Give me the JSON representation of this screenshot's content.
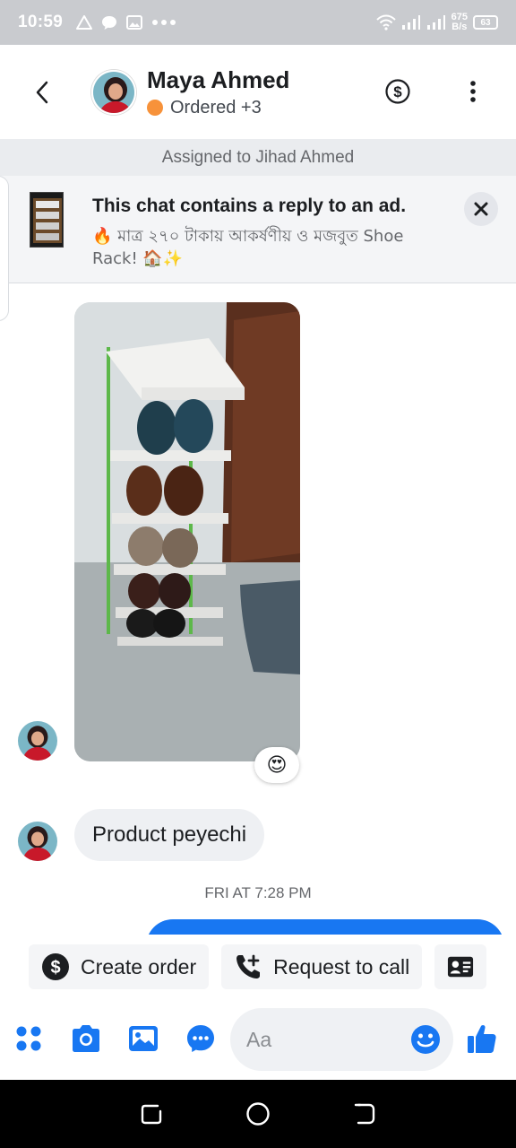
{
  "status_bar": {
    "time": "10:59",
    "network_speed_value": "675",
    "network_speed_unit": "B/s",
    "battery": "63"
  },
  "header": {
    "contact_name": "Maya Ahmed",
    "contact_status": "Ordered +3",
    "status_color": "#f7923a"
  },
  "assigned_banner": "Assigned to Jihad Ahmed",
  "ad_notice": {
    "title": "This chat contains a reply to an ad.",
    "subtitle": "🔥 মাত্র ২৭০ টাকায় আকর্ষণীয় ও মজবুত  Shoe Rack! 🏠✨"
  },
  "messages": {
    "reaction": "😍",
    "text_message": "Product peyechi",
    "timestamp": "FRI AT 7:28 PM"
  },
  "quick_actions": {
    "create_order": "Create order",
    "request_call": "Request to call"
  },
  "composer": {
    "placeholder": "Aa"
  },
  "colors": {
    "accent": "#1877f2",
    "bubble_incoming": "#eef0f3"
  },
  "icons": [
    "back-arrow-icon",
    "dollar-icon",
    "more-icon",
    "close-icon",
    "apps-icon",
    "camera-icon",
    "gallery-icon",
    "messenger-icon",
    "emoji-icon",
    "like-icon",
    "phone-plus-icon",
    "contact-card-icon"
  ]
}
